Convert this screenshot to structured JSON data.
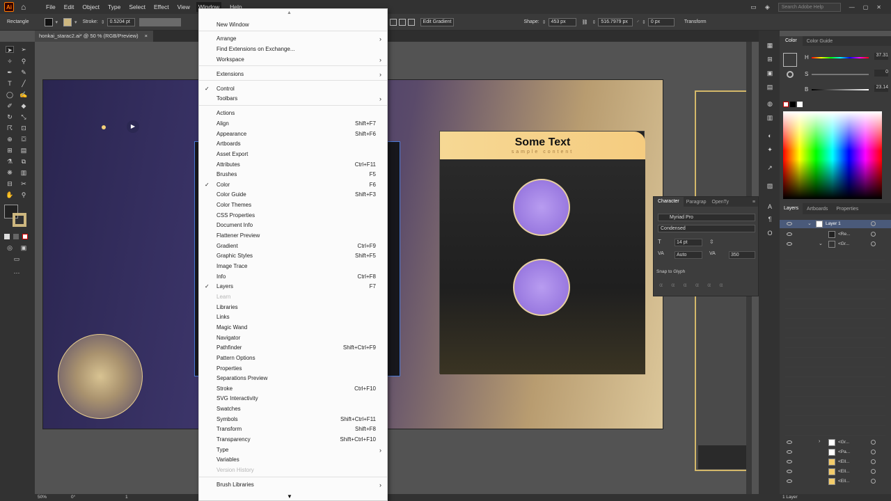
{
  "menubar": {
    "app_logo": "Ai",
    "items": [
      "File",
      "Edit",
      "Object",
      "Type",
      "Select",
      "Effect",
      "View",
      "Window",
      "Help"
    ],
    "search_placeholder": "Search Adobe Help"
  },
  "controlbar": {
    "tool_name": "Rectangle",
    "stroke_label": "Stroke:",
    "stroke_value": "0.5204 pt",
    "edit_gradient": "Edit Gradient",
    "shape_label": "Shape:",
    "width_value": "453 px",
    "height_value": "516.7979 px",
    "radius_value": "0 px",
    "transform_label": "Transform"
  },
  "document": {
    "tab_title": "honkai_starac2.ai* @ 50 % (RGB/Preview)",
    "close": "×"
  },
  "canvas": {
    "card_title": "Some Text",
    "card_subtitle": "sample content",
    "swatches": [
      "#e8907a",
      "#cdb77f",
      "#f6d98c",
      "#f3cc6a",
      "#f0c366"
    ]
  },
  "window_menu": {
    "sections": [
      [
        {
          "label": "New Window"
        }
      ],
      [
        {
          "label": "Arrange",
          "submenu": true
        },
        {
          "label": "Find Extensions on Exchange..."
        },
        {
          "label": "Workspace",
          "submenu": true
        }
      ],
      [
        {
          "label": "Extensions",
          "submenu": true
        }
      ],
      [
        {
          "label": "Control",
          "checked": true
        },
        {
          "label": "Toolbars",
          "submenu": true
        }
      ],
      [
        {
          "label": "Actions"
        },
        {
          "label": "Align",
          "shortcut": "Shift+F7"
        },
        {
          "label": "Appearance",
          "shortcut": "Shift+F6"
        },
        {
          "label": "Artboards"
        },
        {
          "label": "Asset Export"
        },
        {
          "label": "Attributes",
          "shortcut": "Ctrl+F11"
        },
        {
          "label": "Brushes",
          "shortcut": "F5"
        },
        {
          "label": "Color",
          "shortcut": "F6",
          "checked": true
        },
        {
          "label": "Color Guide",
          "shortcut": "Shift+F3"
        },
        {
          "label": "Color Themes"
        },
        {
          "label": "CSS Properties"
        },
        {
          "label": "Document Info"
        },
        {
          "label": "Flattener Preview"
        },
        {
          "label": "Gradient",
          "shortcut": "Ctrl+F9"
        },
        {
          "label": "Graphic Styles",
          "shortcut": "Shift+F5"
        },
        {
          "label": "Image Trace"
        },
        {
          "label": "Info",
          "shortcut": "Ctrl+F8"
        },
        {
          "label": "Layers",
          "shortcut": "F7",
          "checked": true
        },
        {
          "label": "Learn",
          "disabled": true
        },
        {
          "label": "Libraries"
        },
        {
          "label": "Links"
        },
        {
          "label": "Magic Wand"
        },
        {
          "label": "Navigator"
        },
        {
          "label": "Pathfinder",
          "shortcut": "Shift+Ctrl+F9"
        },
        {
          "label": "Pattern Options"
        },
        {
          "label": "Properties"
        },
        {
          "label": "Separations Preview"
        },
        {
          "label": "Stroke",
          "shortcut": "Ctrl+F10"
        },
        {
          "label": "SVG Interactivity"
        },
        {
          "label": "Swatches"
        },
        {
          "label": "Symbols",
          "shortcut": "Shift+Ctrl+F11"
        },
        {
          "label": "Transform",
          "shortcut": "Shift+F8"
        },
        {
          "label": "Transparency",
          "shortcut": "Shift+Ctrl+F10"
        },
        {
          "label": "Type",
          "submenu": true
        },
        {
          "label": "Variables"
        },
        {
          "label": "Version History",
          "disabled": true
        }
      ],
      [
        {
          "label": "Brush Libraries",
          "submenu": true
        }
      ]
    ]
  },
  "color_panel": {
    "tabs": [
      "Color",
      "Color Guide"
    ],
    "h_label": "H",
    "h_value": "37.31",
    "s_label": "S",
    "s_value": "0",
    "b_label": "B",
    "b_value": "23.14"
  },
  "character_panel": {
    "tabs": [
      "Character",
      "Paragrap",
      "OpenTy"
    ],
    "font": "Myriad Pro",
    "style": "Condensed",
    "size": "14 pt",
    "leading": "Auto",
    "tracking": "350",
    "snap": "Snap to Glyph"
  },
  "layers_panel": {
    "tabs": [
      "Layers",
      "Artboards",
      "Properties"
    ],
    "layer1": "Layer 1",
    "rows": [
      "<Re...",
      "<Gr...",
      "<Gr...",
      "<Pa...",
      "<Ell...",
      "<Ell...",
      "<Ell..."
    ],
    "footer": "1 Layer"
  },
  "statusbar": {
    "zoom": "50%",
    "rotation": "0°",
    "artboard": "1"
  }
}
